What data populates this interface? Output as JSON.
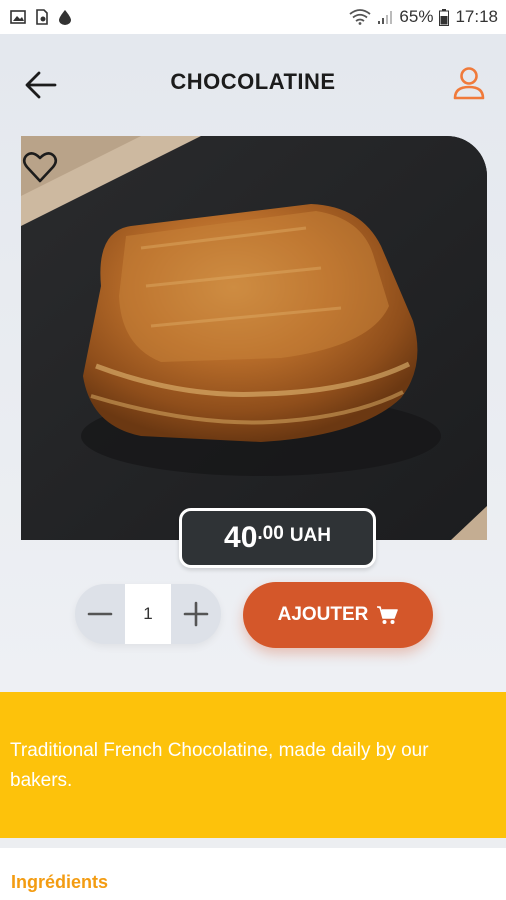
{
  "status_bar": {
    "battery": "65%",
    "time": "17:18"
  },
  "header": {
    "title": "CHOCOLATINE"
  },
  "product": {
    "price_integer": "40",
    "price_decimal": ".00",
    "currency": "UAH",
    "quantity": "1",
    "add_label": "AJOUTER",
    "description": "Traditional French Chocolatine, made daily by our bakers."
  },
  "sections": {
    "ingredients_title": "Ingrédients"
  },
  "colors": {
    "accent_orange": "#d4572a",
    "description_bg": "#fdc20b",
    "ingredients_title": "#f39c12",
    "profile_icon": "#f07a3a"
  },
  "icons": {
    "back": "arrow-left-icon",
    "profile": "user-icon",
    "favorite": "heart-outline-icon",
    "minus": "minus-icon",
    "plus": "plus-icon",
    "cart": "cart-icon"
  }
}
